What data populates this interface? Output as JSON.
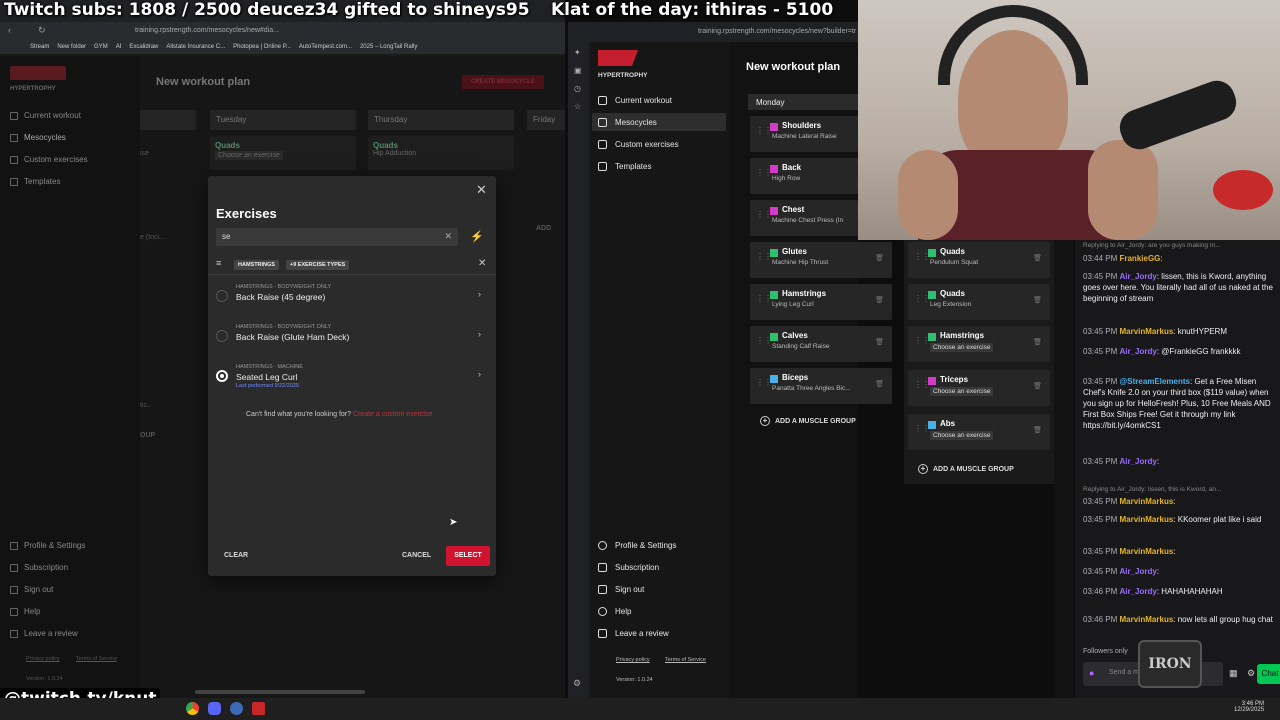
{
  "overlay": {
    "subs": "Twitch subs: 1808 / 2500  deucez34 gifted to shineys95",
    "klat": "Klat of the day: ithiras - 5100",
    "handle": "@twitch.tv/knut"
  },
  "left_browser": {
    "url": "training.rpstrength.com/mesocycles/new#dia...",
    "bookmarks": [
      "Stream",
      "New folder",
      "GYM",
      "AI",
      "Excalidraw",
      "Allstate Insurance C...",
      "Photopea | Online P...",
      "AutoTempest.com...",
      "2025 – LongTail Rally"
    ],
    "app": {
      "brand": "HYPERTROPHY",
      "page_title": "New workout plan",
      "create_button": "CREATE MESOCYCLE",
      "nav": [
        "Current workout",
        "Mesocycles",
        "Custom exercises",
        "Templates"
      ],
      "nav_bottom": [
        "Profile & Settings",
        "Subscription",
        "Sign out",
        "Help",
        "Leave a review"
      ],
      "footer": [
        "Privacy policy",
        "Terms of Service"
      ],
      "version": "Version: 1.0.24",
      "days": [
        "Tuesday",
        "Thursday",
        "Friday"
      ],
      "bg_cards": [
        {
          "muscle": "Quads",
          "exercise": "Choose an exercise"
        },
        {
          "muscle": "Quads",
          "exercise": "Hip Adduction"
        }
      ],
      "bg_fragments": {
        "ise": "ise",
        "inc": "e (Inci...",
        "tic": "tic..",
        "oup": "OUP",
        "add": "ADD"
      }
    },
    "modal": {
      "title": "Exercises",
      "search_value": "se",
      "filter_chip": "HAMSTRINGS",
      "filter_more": "+9 EXERCISE TYPES",
      "items": [
        {
          "category": "HAMSTRINGS - BODYWEIGHT ONLY",
          "name": "Back Raise (45 degree)",
          "selected": false,
          "note": ""
        },
        {
          "category": "HAMSTRINGS - BODYWEIGHT ONLY",
          "name": "Back Raise (Glute Ham Deck)",
          "selected": false,
          "note": ""
        },
        {
          "category": "HAMSTRINGS - MACHINE",
          "name": "Seated Leg Curl",
          "selected": true,
          "note": "Last performed 9/22/2025"
        }
      ],
      "cant_find": "Can't find what you're looking for?",
      "custom_link": "Create a custom exercise",
      "clear": "CLEAR",
      "cancel": "CANCEL",
      "select": "SELECT"
    }
  },
  "right_browser": {
    "url": "training.rpstrength.com/mesocycles/new?builder=tr",
    "brand": "HYPERTROPHY",
    "page_title": "New workout plan",
    "nav": [
      "Current workout",
      "Mesocycles",
      "Custom exercises",
      "Templates"
    ],
    "nav_bottom": [
      "Profile & Settings",
      "Subscription",
      "Sign out",
      "Help",
      "Leave a review"
    ],
    "footer": [
      "Privacy policy",
      "Terms of Service"
    ],
    "version": "Version: 1.0.24",
    "day": "Monday",
    "col1": [
      {
        "muscle": "Shoulders",
        "exercise": "Machine Lateral Raise",
        "color": "#d63bc8"
      },
      {
        "muscle": "Back",
        "exercise": "High Row",
        "color": "#d63bc8"
      },
      {
        "muscle": "Chest",
        "exercise": "Machine Chest Press (In",
        "color": "#d63bc8"
      },
      {
        "muscle": "Glutes",
        "exercise": "Machine Hip Thrust",
        "color": "#2fbf71"
      },
      {
        "muscle": "Hamstrings",
        "exercise": "Lying Leg Curl",
        "color": "#2fbf71"
      },
      {
        "muscle": "Calves",
        "exercise": "Standing Calf Raise",
        "color": "#2fbf71"
      },
      {
        "muscle": "Biceps",
        "exercise": "Panatta Three Angles Bic...",
        "color": "#4ab0e8"
      }
    ],
    "col2": [
      {
        "muscle": "Quads",
        "exercise": "Pendulum Squat",
        "color": "#2fbf71",
        "choose": false
      },
      {
        "muscle": "Quads",
        "exercise": "Leg Extension",
        "color": "#2fbf71",
        "choose": false
      },
      {
        "muscle": "Hamstrings",
        "exercise": "Choose an exercise",
        "color": "#2fbf71",
        "choose": true
      },
      {
        "muscle": "Triceps",
        "exercise": "Choose an exercise",
        "color": "#d63bc8",
        "choose": true
      },
      {
        "muscle": "Abs",
        "exercise": "Choose an exercise",
        "color": "#4ab0e8",
        "choose": true
      }
    ],
    "add_group": "ADD A MUSCLE GROUP"
  },
  "chat": {
    "messages": [
      {
        "reply": "Replying to Air_Jordy: are you guys making m..."
      },
      {
        "time": "03:44 PM",
        "user": "FrankieGG",
        "color": "#e6b422",
        "text": ""
      },
      {
        "time": "03:45 PM",
        "user": "Air_Jordy",
        "color": "#9b6cff",
        "text": "lissen, this is Kword, anything goes over here. You literally had all of us naked at the beginning of stream"
      },
      {
        "time": "03:45 PM",
        "user": "MarvinMarkus",
        "color": "#e6b422",
        "text": "knutHYPERM"
      },
      {
        "time": "03:45 PM",
        "user": "Air_Jordy",
        "color": "#9b6cff",
        "text": "@FrankieGG frankkkk"
      },
      {
        "time": "03:45 PM",
        "user": "@StreamElements",
        "color": "#4ab0e8",
        "text": "Get a Free Misen Chef's Knife 2.0 on your third box ($119 value) when you sign up for HelloFresh! Plus, 10 Free Meals AND First Box Ships Free! Get it through my link https://bit.ly/4omkCS1"
      },
      {
        "time": "03:45 PM",
        "user": "Air_Jordy",
        "color": "#9b6cff",
        "text": ""
      },
      {
        "reply": "Replying to Air_Jordy: lissen, this is Kword, an..."
      },
      {
        "time": "03:45 PM",
        "user": "MarvinMarkus",
        "color": "#e6b422",
        "text": ""
      },
      {
        "time": "03:45 PM",
        "user": "MarvinMarkus",
        "color": "#e6b422",
        "text": "KKoomer plat like i said"
      },
      {
        "time": "03:45 PM",
        "user": "MarvinMarkus",
        "color": "#e6b422",
        "text": ""
      },
      {
        "time": "03:45 PM",
        "user": "Air_Jordy",
        "color": "#9b6cff",
        "text": ""
      },
      {
        "time": "03:46 PM",
        "user": "Air_Jordy",
        "color": "#9b6cff",
        "text": "HAHAHAHAHAH"
      },
      {
        "time": "03:46 PM",
        "user": "MarvinMarkus",
        "color": "#e6b422",
        "text": "now lets all group hug chat"
      }
    ],
    "followers_only": "Followers only",
    "send_placeholder": "Send a message",
    "chat_button": "Chat"
  },
  "taskbar": {
    "time": "3:46 PM",
    "date": "12/29/2025"
  }
}
